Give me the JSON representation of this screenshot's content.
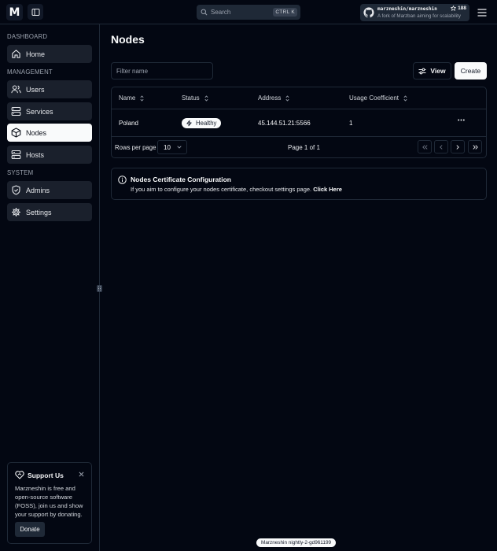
{
  "colors": {
    "background": "#030712",
    "surface": "#1f2937",
    "accent": "#f9fafb",
    "border": "#1f2937"
  },
  "topbar": {
    "logo_letter": "M",
    "search": {
      "label": "Search",
      "shortcut": "CTRL K"
    },
    "repo": {
      "name": "marzneshin/marzneshin",
      "stars": "188",
      "description": "A fork of Marzban aiming for scalability"
    }
  },
  "sidebar": {
    "sections": [
      {
        "label": "DASHBOARD",
        "items": [
          {
            "label": "Home",
            "icon": "home-icon"
          }
        ]
      },
      {
        "label": "MANAGEMENT",
        "items": [
          {
            "label": "Users",
            "icon": "users-icon"
          },
          {
            "label": "Services",
            "icon": "server-icon"
          },
          {
            "label": "Nodes",
            "icon": "box-icon",
            "active": true
          },
          {
            "label": "Hosts",
            "icon": "globe-icon"
          }
        ]
      },
      {
        "label": "SYSTEM",
        "items": [
          {
            "label": "Admins",
            "icon": "shield-icon"
          },
          {
            "label": "Settings",
            "icon": "gear-icon"
          }
        ]
      }
    ],
    "support": {
      "title": "Support Us",
      "text": "Marzneshin is free and open-source software (FOSS), join us and show your support by donating.",
      "button": "Donate"
    }
  },
  "main": {
    "title": "Nodes",
    "filter_placeholder": "Filter name",
    "view_label": "View",
    "create_label": "Create",
    "table": {
      "columns": [
        "Name",
        "Status",
        "Address",
        "Usage Coefficient"
      ],
      "rows": [
        {
          "name": "Poland",
          "status": "Healthy",
          "address": "45.144.51.21:5566",
          "usage": "1"
        }
      ]
    },
    "pagination": {
      "rows_label": "Rows per page",
      "rows_value": "10",
      "page_info": "Page 1 of 1"
    },
    "cert": {
      "title": "Nodes Certificate Configuration",
      "text": "If you aim to configure your nodes certificate, checkout settings page.",
      "link": "Click Here"
    }
  },
  "footer": {
    "version": "Marzneshin nightly-2-gd961199"
  }
}
